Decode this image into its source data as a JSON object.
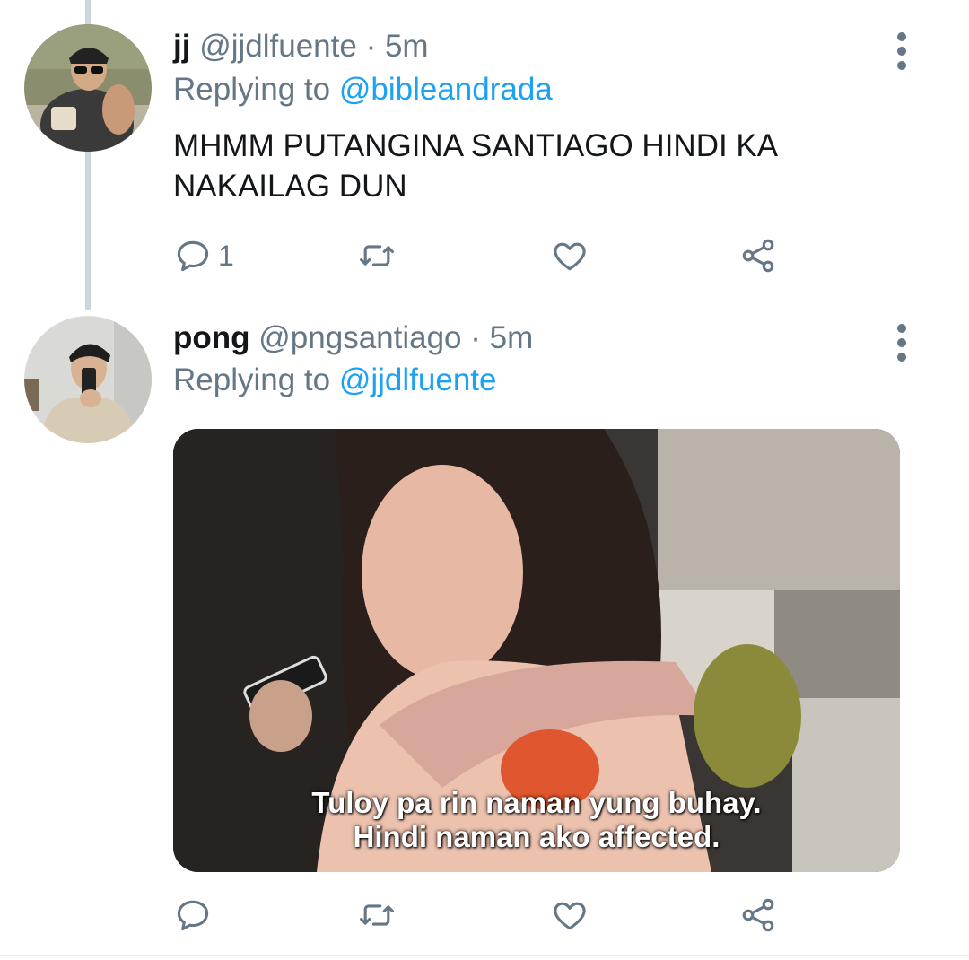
{
  "tweets": [
    {
      "name": "jj",
      "handle": "@jjdlfuente",
      "separator": "·",
      "time": "5m",
      "replying_prefix": "Replying to",
      "replying_to": "@bibleandrada",
      "text": "MHMM PUTANGINA SANTIAGO HINDI KA NAKAILAG DUN",
      "reply_count": "1"
    },
    {
      "name": "pong",
      "handle": "@pngsantiago",
      "separator": "·",
      "time": "5m",
      "replying_prefix": "Replying to",
      "replying_to": "@jjdlfuente",
      "media_caption_line1": "Tuloy pa rin naman yung buhay.",
      "media_caption_line2": "Hindi naman ako affected."
    }
  ],
  "icons": [
    "reply-icon",
    "retweet-icon",
    "like-icon",
    "share-icon",
    "more-options-icon"
  ],
  "colors": {
    "link": "#1da1f2",
    "secondary": "#657786",
    "thread_line": "#ccd6dd"
  }
}
